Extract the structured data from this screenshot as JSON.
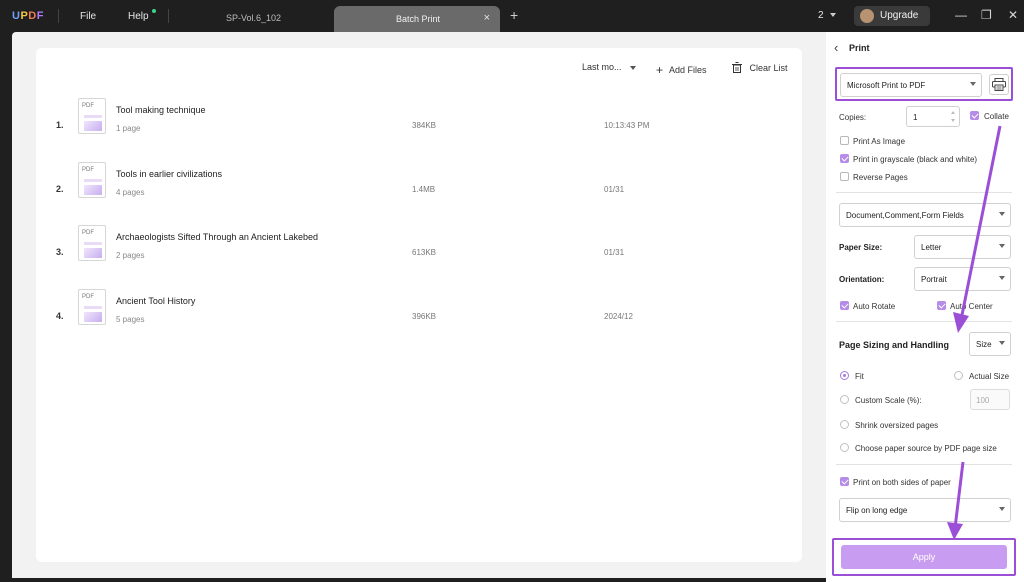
{
  "titlebar": {
    "logo": "UPDF",
    "menu_file": "File",
    "menu_help": "Help",
    "tab_inactive": "SP-Vol.6_102",
    "tab_active": "Batch Print",
    "tab_close": "×",
    "new_tab": "+",
    "window_count": "2",
    "upgrade_label": "Upgrade",
    "minimize": "—",
    "restore": "❐",
    "close": "✕",
    "colors": {
      "dot": "#3fd28a",
      "accent": "#9b4fd6"
    }
  },
  "toolbar": {
    "sort_label": "Last mo...",
    "add_files_icon": "+",
    "add_files": "Add Files",
    "clear_list": "Clear List"
  },
  "files": [
    {
      "num": "1.",
      "icon_text": "PDF",
      "title": "Tool making technique",
      "pages": "1 page",
      "size": "384KB",
      "date": "10:13:43 PM"
    },
    {
      "num": "2.",
      "icon_text": "PDF",
      "title": "Tools in earlier civilizations",
      "pages": "4 pages",
      "size": "1.4MB",
      "date": "01/31"
    },
    {
      "num": "3.",
      "icon_text": "PDF",
      "title": "Archaeologists Sifted Through an Ancient Lakebed",
      "pages": "2 pages",
      "size": "613KB",
      "date": "01/31"
    },
    {
      "num": "4.",
      "icon_text": "PDF",
      "title": "Ancient Tool History",
      "pages": "5 pages",
      "size": "396KB",
      "date": "2024/12"
    }
  ],
  "print_panel": {
    "back_icon": "‹",
    "title": "Print",
    "printer": "Microsoft Print to PDF",
    "copies_label": "Copies:",
    "copies_value": "1",
    "collate": "Collate",
    "print_as_image": "Print As Image",
    "print_grayscale": "Print in grayscale (black and white)",
    "reverse_pages": "Reverse Pages",
    "content": "Document,Comment,Form Fields",
    "paper_size_label": "Paper Size:",
    "paper_size": "Letter",
    "orientation_label": "Orientation:",
    "orientation": "Portrait",
    "auto_rotate": "Auto Rotate",
    "auto_center": "Auto Center",
    "sizing_label": "Page Sizing and Handling",
    "sizing_value": "Size",
    "fit": "Fit",
    "actual_size": "Actual Size",
    "custom_scale": "Custom Scale (%):",
    "custom_scale_value": "100",
    "shrink": "Shrink oversized pages",
    "choose_source": "Choose paper source by PDF page size",
    "both_sides": "Print on both sides of paper",
    "flip": "Flip on long edge",
    "apply": "Apply",
    "checked": {
      "collate": true,
      "print_as_image": false,
      "print_grayscale": true,
      "reverse_pages": false,
      "auto_rotate": true,
      "auto_center": true,
      "both_sides": true
    }
  }
}
